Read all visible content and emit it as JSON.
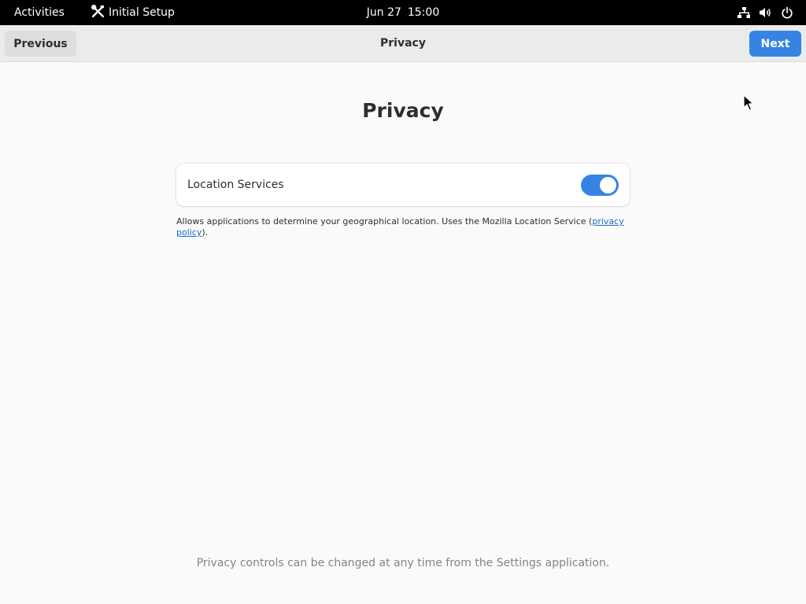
{
  "topbar": {
    "activities_label": "Activities",
    "app_name": "Initial Setup",
    "date": "Jun 27",
    "time": "15:00",
    "status_icons": [
      "network-wired-icon",
      "volume-icon",
      "power-icon"
    ]
  },
  "headerbar": {
    "previous_label": "Previous",
    "title": "Privacy",
    "next_label": "Next"
  },
  "main": {
    "title": "Privacy",
    "location_services": {
      "label": "Location Services",
      "enabled": true
    },
    "description_prefix": "Allows applications to determine your geographical location. Uses the Mozilla Location Service (",
    "privacy_policy_link": "privacy policy",
    "description_suffix": ").",
    "footer_note": "Privacy controls can be changed at any time from the Settings application."
  },
  "colors": {
    "accent": "#3584e4",
    "link": "#1b6acb",
    "topbar_bg": "#000000",
    "window_bg": "#fafafa"
  }
}
